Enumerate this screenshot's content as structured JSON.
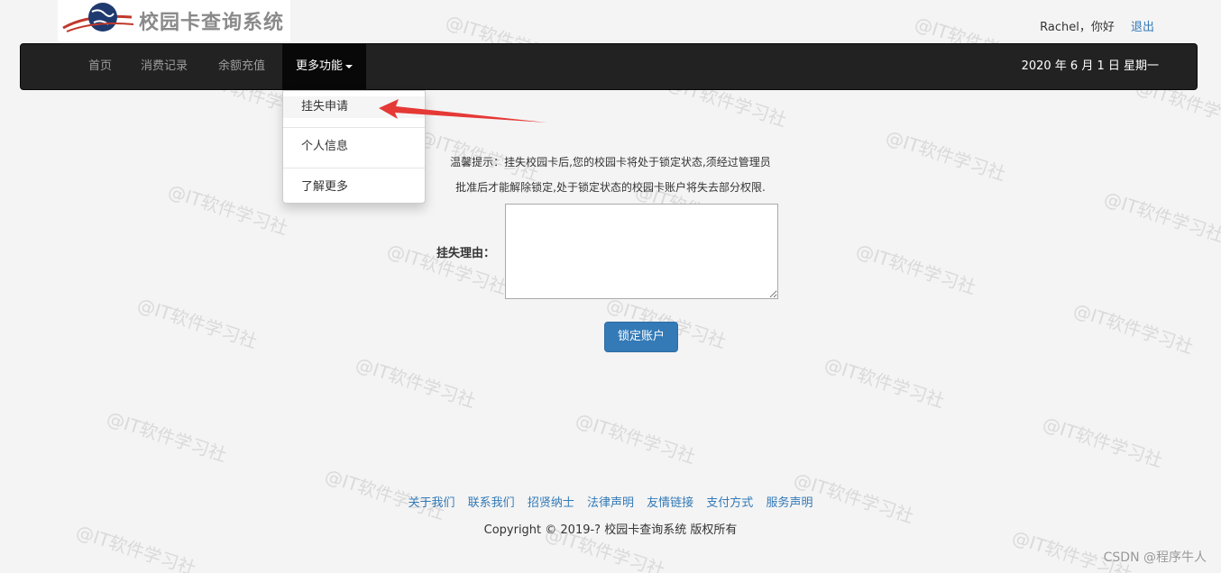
{
  "logo": {
    "text": "校园卡查询系统"
  },
  "user": {
    "greeting": "Rachel，你好",
    "logout": "退出"
  },
  "nav": {
    "items": [
      "首页",
      "消费记录",
      "余额充值"
    ],
    "active": "更多功能",
    "date": "2020 年 6 月 1 日 星期一"
  },
  "dropdown": {
    "items": [
      "挂失申请",
      "个人信息",
      "了解更多"
    ]
  },
  "tip": {
    "line1": "温馨提示：挂失校园卡后,您的校园卡将处于锁定状态,须经过管理员",
    "line2": "批准后才能解除锁定,处于锁定状态的校园卡账户将失去部分权限."
  },
  "form": {
    "reason_label": "挂失理由：",
    "reason_value": "",
    "submit": "锁定账户"
  },
  "footer": {
    "links": [
      "关于我们",
      "联系我们",
      "招贤纳士",
      "法律声明",
      "友情链接",
      "支付方式",
      "服务声明"
    ],
    "copyright": "Copyright © 2019-? 校园卡查询系统 版权所有"
  },
  "watermark": "@IT软件学习社",
  "credit": "CSDN @程序牛人",
  "colors": {
    "navbar": "#222222",
    "link": "#337ab7",
    "button": "#337ab7",
    "arrow": "#e53935"
  }
}
